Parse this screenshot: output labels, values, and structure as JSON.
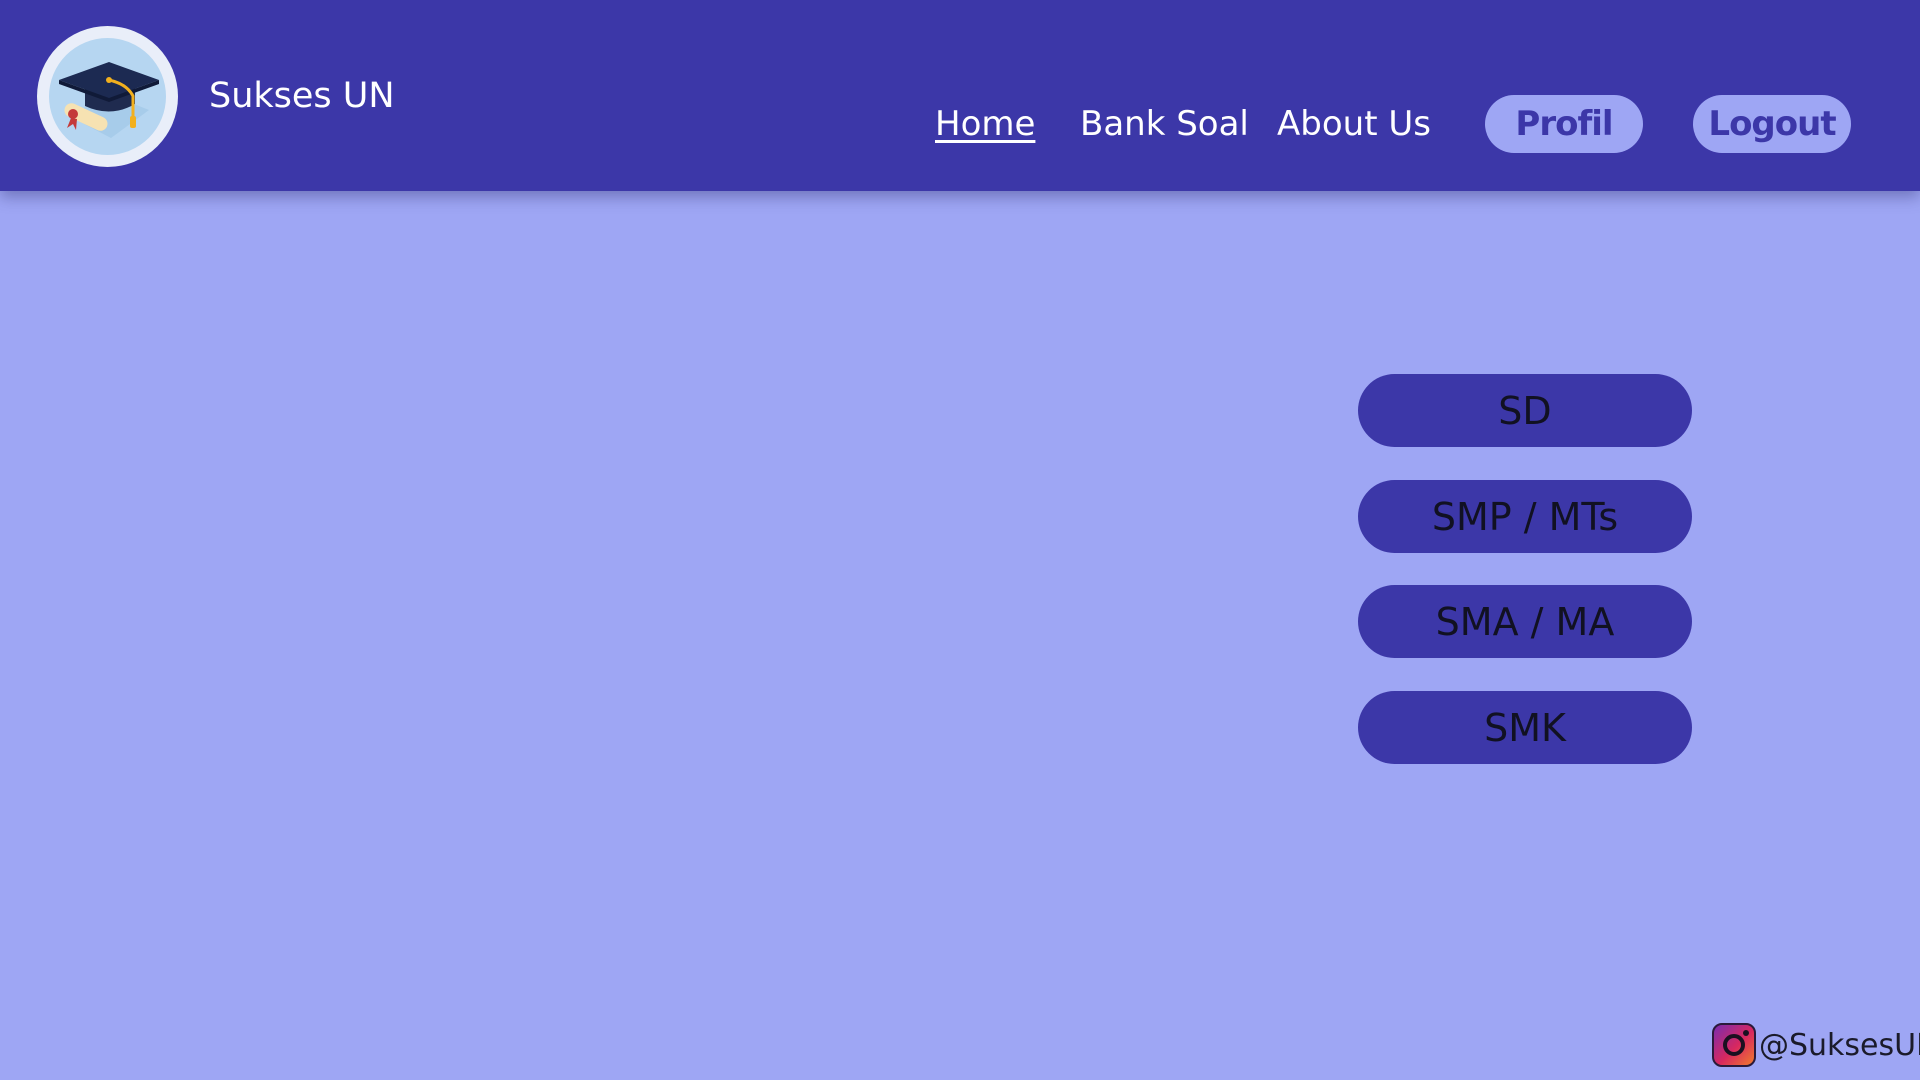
{
  "header": {
    "brand": "Sukses UN",
    "nav": {
      "home": "Home",
      "bank_soal": "Bank Soal",
      "about_us": "About Us"
    },
    "profil_label": "Profil",
    "logout_label": "Logout",
    "logo_icon": "graduation-cap-icon"
  },
  "levels": [
    "SD",
    "SMP / MTs",
    "SMA / MA",
    "SMK"
  ],
  "footer": {
    "instagram_handle": "@SuksesUN",
    "icon": "instagram-icon"
  },
  "colors": {
    "header_bg": "#3c37a8",
    "page_bg": "#9ea6f4",
    "button_bg": "#3c37a8",
    "pill_bg": "#9ea6f4",
    "pill_text": "#3c37a8"
  }
}
